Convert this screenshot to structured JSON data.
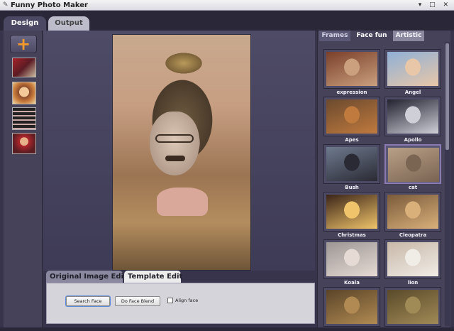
{
  "app": {
    "title": "Funny Photo Maker",
    "window_controls": "▾ □ ✕"
  },
  "main_tabs": [
    {
      "label": "Design",
      "active": true
    },
    {
      "label": "Output",
      "active": false
    }
  ],
  "left_strip": {
    "add_button": "+",
    "accent_color": "#f29a2a"
  },
  "edit_tabs": [
    {
      "label": "Original Image Edit",
      "active": false
    },
    {
      "label": "Template Edit",
      "active": true
    }
  ],
  "edit_panel": {
    "search_face": "Search Face",
    "face_blend": "Do Face Blend",
    "align_face": "Align face",
    "align_checked": false
  },
  "right_tabs": [
    {
      "label": "Frames",
      "active": false
    },
    {
      "label": "Face fun",
      "active": true
    },
    {
      "label": "Artistic",
      "active": false
    }
  ],
  "templates": [
    {
      "label": "expression",
      "colors": [
        "#7a3f2a",
        "#caa07e"
      ]
    },
    {
      "label": "Angel",
      "colors": [
        "#8fb0d6",
        "#e8c7a8"
      ]
    },
    {
      "label": "Apes",
      "colors": [
        "#6b4a2e",
        "#c07a3e"
      ]
    },
    {
      "label": "Apollo",
      "colors": [
        "#222230",
        "#cfcfd8"
      ]
    },
    {
      "label": "Bush",
      "colors": [
        "#6e7a8e",
        "#2a2a34"
      ]
    },
    {
      "label": "cat",
      "colors": [
        "#b89f86",
        "#7a6452"
      ]
    },
    {
      "label": "Christmas",
      "colors": [
        "#3a2418",
        "#f0c46a"
      ]
    },
    {
      "label": "Cleopatra",
      "colors": [
        "#7a5a3a",
        "#d9b07a"
      ]
    },
    {
      "label": "Koala",
      "colors": [
        "#9c9694",
        "#e6dbd4"
      ]
    },
    {
      "label": "lion",
      "colors": [
        "#c8b8a8",
        "#f0ece6"
      ]
    },
    {
      "label": "",
      "colors": [
        "#5a4428",
        "#b08a52"
      ]
    },
    {
      "label": "",
      "colors": [
        "#5a4a2a",
        "#a08a56"
      ]
    }
  ]
}
